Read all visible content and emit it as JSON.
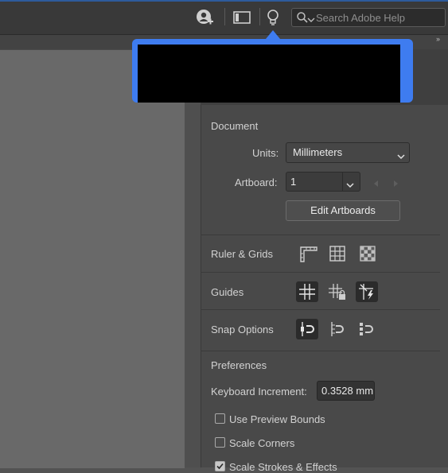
{
  "top_bar": {
    "search": {
      "placeholder": "Search Adobe Help"
    },
    "icons": [
      "add-user-icon",
      "panel-layout-icon",
      "lightbulb-icon",
      "search-icon"
    ]
  },
  "tooltip": {
    "content": ""
  },
  "panel": {
    "document": {
      "section_title": "Document",
      "units_label": "Units:",
      "units_value": "Millimeters",
      "artboard_label": "Artboard:",
      "artboard_value": "1",
      "edit_artboards_label": "Edit Artboards"
    },
    "ruler_grids": {
      "label": "Ruler & Grids",
      "icons": [
        "ruler-icon",
        "grid-icon",
        "transparency-grid-icon"
      ]
    },
    "guides": {
      "label": "Guides",
      "icons": [
        "guides-icon",
        "lock-guides-icon",
        "smart-guides-icon"
      ]
    },
    "snap_options": {
      "label": "Snap Options",
      "icons": [
        "snap-to-point-icon",
        "snap-to-grid-icon",
        "snap-to-pixel-icon"
      ]
    },
    "preferences": {
      "section_title": "Preferences",
      "keyboard_increment_label": "Keyboard Increment:",
      "keyboard_increment_value": "0.3528 mm",
      "checkboxes": [
        {
          "label": "Use Preview Bounds",
          "checked": false
        },
        {
          "label": "Scale Corners",
          "checked": false
        },
        {
          "label": "Scale Strokes & Effects",
          "checked": true
        }
      ]
    }
  },
  "colors": {
    "accent": "#3e7cf0",
    "panel_bg": "#494949",
    "canvas_bg": "#696969"
  }
}
